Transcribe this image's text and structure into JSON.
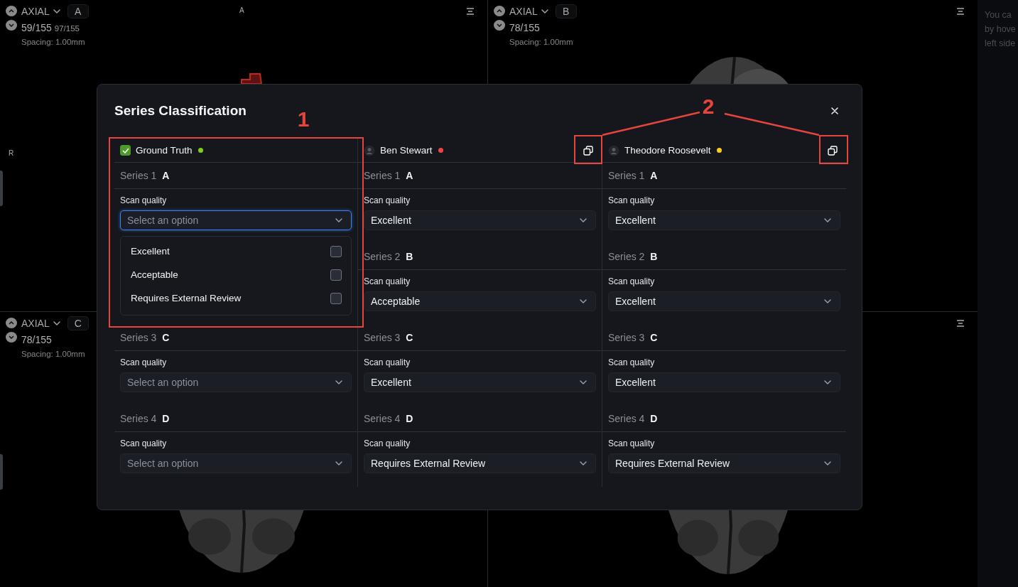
{
  "viewports": [
    {
      "view": "AXIAL",
      "badge": "A",
      "slice": "59/155",
      "slice_secondary": "97/155",
      "spacing": "Spacing: 1.00mm",
      "markers": [
        {
          "kind": "top",
          "text": "A"
        },
        {
          "kind": "left",
          "text": "R"
        }
      ],
      "menu": true,
      "image": {
        "kind": "picture"
      }
    },
    {
      "view": "AXIAL",
      "badge": "B",
      "slice": "78/155",
      "spacing": "Spacing: 1.00mm",
      "menu": true,
      "image": {
        "kind": "picture"
      }
    },
    {
      "view": "AXIAL",
      "badge": "C",
      "slice": "78/155",
      "spacing": "Spacing: 1.00mm",
      "image": {
        "kind": "picture"
      }
    },
    {
      "menu": true,
      "image": {
        "kind": "picture"
      }
    }
  ],
  "side_panel": {
    "lines": [
      "You ca",
      "by hove",
      "left side"
    ]
  },
  "modal": {
    "title": "Series Classification",
    "columns": [
      {
        "kind": "ground_truth",
        "name": "Ground Truth",
        "checked": true,
        "color": "#84cc16",
        "series": [
          {
            "label": "Series 1",
            "letter": "A",
            "field_label": "Scan quality",
            "placeholder": "Select an option",
            "focused": true,
            "options": [
              {
                "label": "Excellent",
                "checked": false
              },
              {
                "label": "Acceptable",
                "checked": false
              },
              {
                "label": "Requires External Review",
                "checked": false
              }
            ]
          },
          {
            "label": "Series 3",
            "letter": "C",
            "field_label": "Scan quality",
            "placeholder": "Select an option"
          },
          {
            "label": "Series 4",
            "letter": "D",
            "field_label": "Scan quality",
            "placeholder": "Select an option"
          }
        ]
      },
      {
        "kind": "annotator",
        "name": "Ben Stewart",
        "color": "#ef4444",
        "series": [
          {
            "label": "Series 1",
            "letter": "A",
            "field_label": "Scan quality",
            "value": "Excellent"
          },
          {
            "label": "Series 2",
            "letter": "B",
            "field_label": "Scan quality",
            "value": "Acceptable"
          },
          {
            "label": "Series 3",
            "letter": "C",
            "field_label": "Scan quality",
            "value": "Excellent"
          },
          {
            "label": "Series 4",
            "letter": "D",
            "field_label": "Scan quality",
            "value": "Requires External Review"
          }
        ]
      },
      {
        "kind": "annotator",
        "name": "Theodore Roosevelt",
        "color": "#facc15",
        "series": [
          {
            "label": "Series 1",
            "letter": "A",
            "field_label": "Scan quality",
            "value": "Excellent"
          },
          {
            "label": "Series 2",
            "letter": "B",
            "field_label": "Scan quality",
            "value": "Excellent"
          },
          {
            "label": "Series 3",
            "letter": "C",
            "field_label": "Scan quality",
            "value": "Excellent"
          },
          {
            "label": "Series 4",
            "letter": "D",
            "field_label": "Scan quality",
            "value": "Requires External Review"
          }
        ]
      }
    ]
  },
  "annotations": [
    {
      "label": "1"
    },
    {
      "label": "2"
    }
  ]
}
